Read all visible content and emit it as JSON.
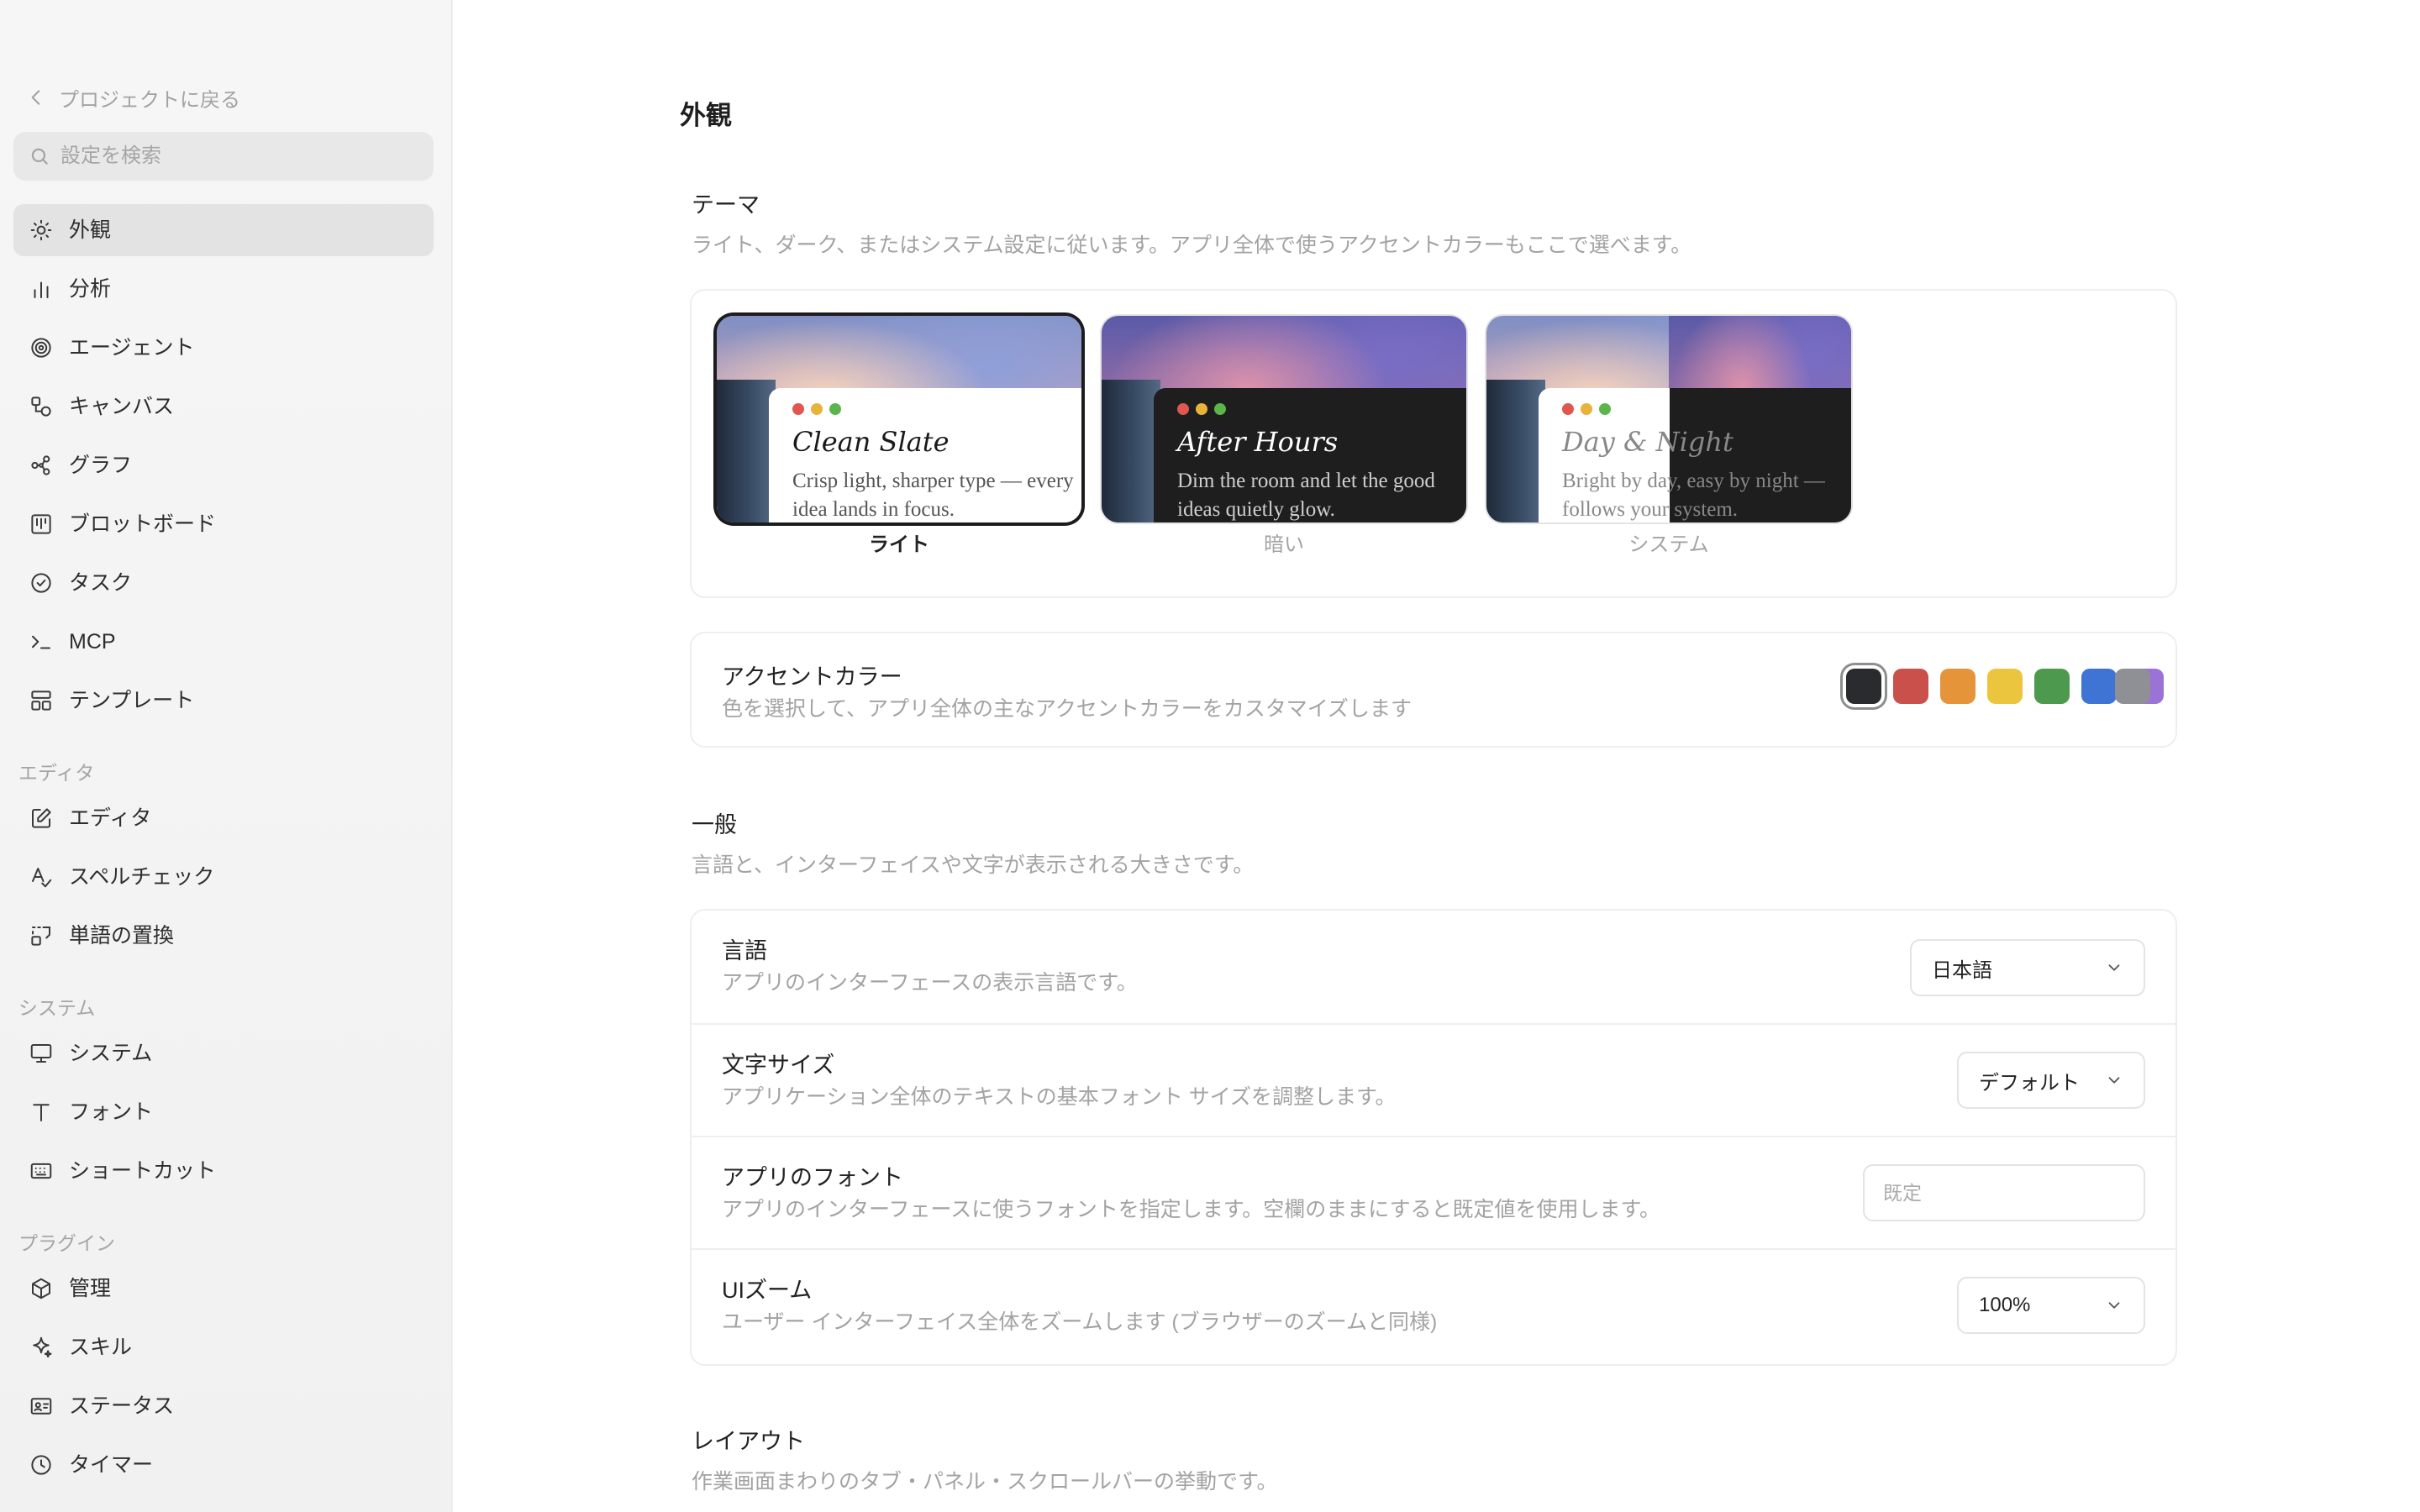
{
  "sidebar": {
    "back_label": "プロジェクトに戻る",
    "search_placeholder": "設定を検索",
    "items": [
      {
        "label": "外観",
        "icon": "sun-icon"
      },
      {
        "label": "分析",
        "icon": "bar-chart-icon"
      },
      {
        "label": "エージェント",
        "icon": "spiral-icon"
      },
      {
        "label": "キャンバス",
        "icon": "shapes-icon"
      },
      {
        "label": "グラフ",
        "icon": "graph-icon"
      },
      {
        "label": "ブロットボード",
        "icon": "kanban-icon"
      },
      {
        "label": "タスク",
        "icon": "check-circle-icon"
      },
      {
        "label": "MCP",
        "icon": "terminal-icon"
      },
      {
        "label": "テンプレート",
        "icon": "layout-icon"
      }
    ],
    "section_editor": "エディタ",
    "editor_items": [
      {
        "label": "エディタ",
        "icon": "edit-icon"
      },
      {
        "label": "スペルチェック",
        "icon": "spellcheck-icon"
      },
      {
        "label": "単語の置換",
        "icon": "replace-icon"
      }
    ],
    "section_system": "システム",
    "system_items": [
      {
        "label": "システム",
        "icon": "monitor-icon"
      },
      {
        "label": "フォント",
        "icon": "type-icon"
      },
      {
        "label": "ショートカット",
        "icon": "keyboard-icon"
      }
    ],
    "section_plugin": "プラグイン",
    "plugin_items": [
      {
        "label": "管理",
        "icon": "package-icon"
      },
      {
        "label": "スキル",
        "icon": "sparkle-icon"
      },
      {
        "label": "ステータス",
        "icon": "id-card-icon"
      },
      {
        "label": "タイマー",
        "icon": "clock-icon"
      }
    ]
  },
  "main": {
    "page_title": "外観",
    "theme": {
      "heading": "テーマ",
      "description": "ライト、ダーク、またはシステム設定に従います。アプリ全体で使うアクセントカラーもここで選べます。",
      "options": [
        {
          "title": "Clean Slate",
          "desc": "Crisp light, sharper type — every idea lands in focus.",
          "label": "ライト",
          "selected": true
        },
        {
          "title": "After Hours",
          "desc": "Dim the room and let the good ideas quietly glow.",
          "label": "暗い",
          "selected": false
        },
        {
          "title": "Day & Night",
          "desc": "Bright by day, easy by night — follows your system.",
          "label": "システム",
          "selected": false
        }
      ],
      "window_dots": [
        "#e0574f",
        "#e8b33a",
        "#5bb54a"
      ]
    },
    "accent": {
      "title": "アクセントカラー",
      "description": "色を選択して、アプリ全体の主なアクセントカラーをカスタマイズします",
      "colors": [
        "#2a2b2e",
        "#c9504b",
        "#e5943a",
        "#ecc53f",
        "#4d9a4f",
        "#3f74d4",
        "#9b72d6",
        "#8e9095"
      ],
      "selected_index": 0
    },
    "general": {
      "heading": "一般",
      "description": "言語と、インターフェイスや文字が表示される大きさです。",
      "language": {
        "title": "言語",
        "description": "アプリのインターフェースの表示言語です。",
        "value": "日本語"
      },
      "font_size": {
        "title": "文字サイズ",
        "description": "アプリケーション全体のテキストの基本フォント サイズを調整します。",
        "value": "デフォルト"
      },
      "app_font": {
        "title": "アプリのフォント",
        "description": "アプリのインターフェースに使うフォントを指定します。空欄のままにすると既定値を使用します。",
        "placeholder": "既定"
      },
      "ui_zoom": {
        "title": "UIズーム",
        "description": "ユーザー インターフェイス全体をズームします (ブラウザーのズームと同様)",
        "value": "100%"
      }
    },
    "layout": {
      "heading": "レイアウト",
      "description": "作業画面まわりのタブ・パネル・スクロールバーの挙動です。"
    }
  }
}
